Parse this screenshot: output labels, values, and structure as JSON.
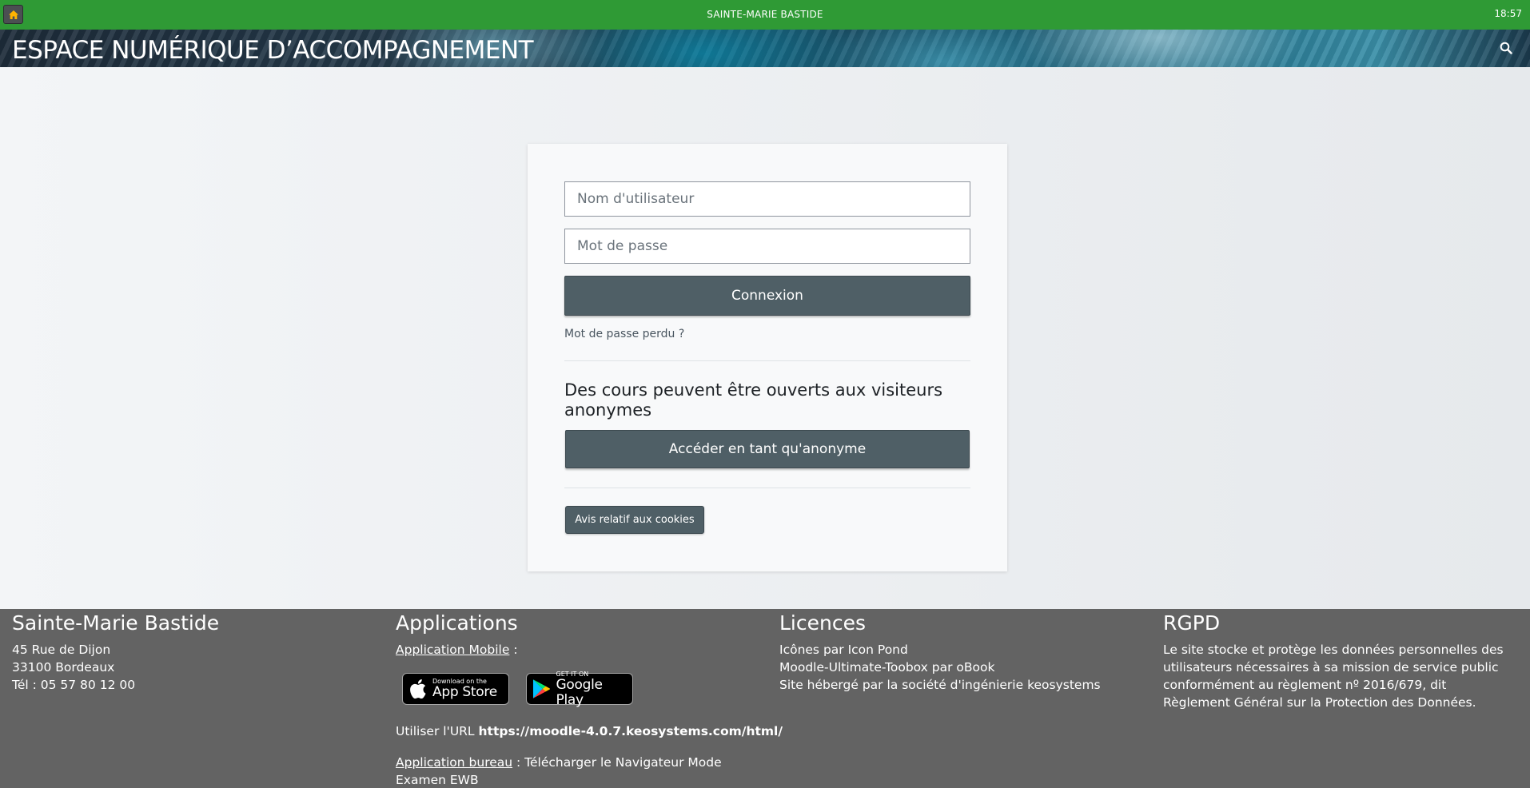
{
  "topbar": {
    "title": "SAINTE-MARIE BASTIDE",
    "time": "18:57"
  },
  "banner": {
    "title": "ESPACE NUMÉRIQUE D’ACCOMPAGNEMENT"
  },
  "login": {
    "username_placeholder": "Nom d'utilisateur",
    "password_placeholder": "Mot de passe",
    "submit_label": "Connexion",
    "forgot_link": "Mot de passe perdu ?",
    "guest_title": "Des cours peuvent être ouverts aux visiteurs anonymes",
    "guest_button": "Accéder en tant qu'anonyme",
    "cookies_button": "Avis relatif aux cookies"
  },
  "footer": {
    "school": {
      "title": "Sainte-Marie Bastide",
      "address1": "45 Rue de Dijon",
      "address2": "33100 Bordeaux",
      "phone": "Tél : 05 57 80 12 00"
    },
    "apps": {
      "title": "Applications",
      "mobile_link": "Application Mobile",
      "mobile_suffix": " :",
      "appstore_small": "Download on the",
      "appstore_big": "App Store",
      "googleplay_small": "GET IT ON",
      "googleplay_big": "Google Play",
      "url_prefix": "Utiliser l'URL ",
      "url": "https://moodle-4.0.7.keosystems.com/html/",
      "desktop_link": "Application bureau",
      "desktop_text": " : Télécharger le Navigateur Mode Examen EWB"
    },
    "licences": {
      "title": "Licences",
      "line1": "Icônes par Icon Pond",
      "line2": "Moodle-Ultimate-Toobox par oBook",
      "line3": "Site hébergé par la société d'ingénierie keosystems"
    },
    "rgpd": {
      "title": "RGPD",
      "text": "Le site stocke et protège les données personnelles des utilisateurs nécessaires à sa mission de service public conformément au règlement nº 2016/679, dit Règlement Général sur la Protection des Données."
    }
  }
}
